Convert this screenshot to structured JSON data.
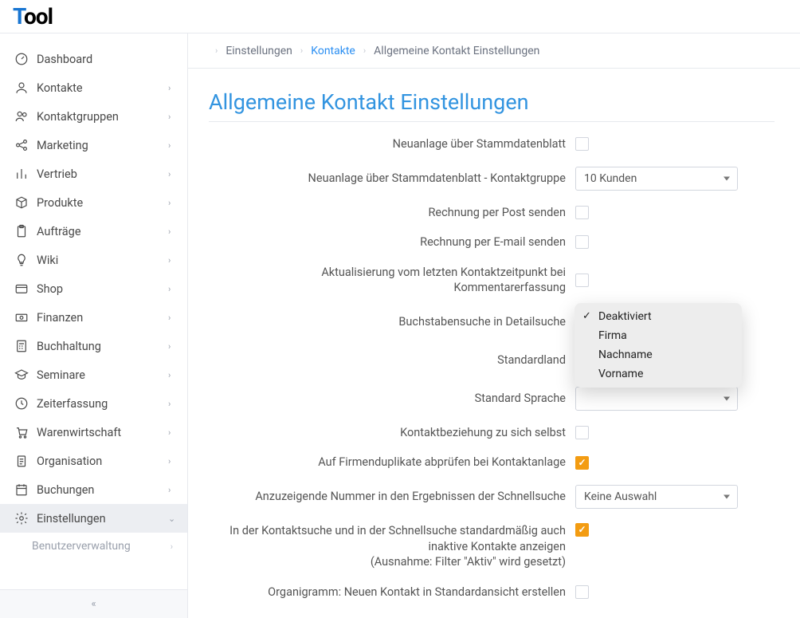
{
  "logo": {
    "t": "T",
    "rest": "ool"
  },
  "sidebar": {
    "items": [
      {
        "id": "dashboard",
        "label": "Dashboard",
        "icon": "gauge",
        "expandable": false
      },
      {
        "id": "kontakte",
        "label": "Kontakte",
        "icon": "user",
        "expandable": true
      },
      {
        "id": "kontaktgruppen",
        "label": "Kontaktgruppen",
        "icon": "users",
        "expandable": true
      },
      {
        "id": "marketing",
        "label": "Marketing",
        "icon": "share",
        "expandable": true
      },
      {
        "id": "vertrieb",
        "label": "Vertrieb",
        "icon": "bars",
        "expandable": true
      },
      {
        "id": "produkte",
        "label": "Produkte",
        "icon": "cube",
        "expandable": true
      },
      {
        "id": "auftraege",
        "label": "Aufträge",
        "icon": "clipboard",
        "expandable": true
      },
      {
        "id": "wiki",
        "label": "Wiki",
        "icon": "bulb",
        "expandable": true
      },
      {
        "id": "shop",
        "label": "Shop",
        "icon": "card",
        "expandable": true
      },
      {
        "id": "finanzen",
        "label": "Finanzen",
        "icon": "money",
        "expandable": true
      },
      {
        "id": "buchhaltung",
        "label": "Buchhaltung",
        "icon": "calc",
        "expandable": true
      },
      {
        "id": "seminare",
        "label": "Seminare",
        "icon": "gradcap",
        "expandable": true
      },
      {
        "id": "zeiterfassung",
        "label": "Zeiterfassung",
        "icon": "clock",
        "expandable": true
      },
      {
        "id": "warenwirtschaft",
        "label": "Warenwirtschaft",
        "icon": "cart",
        "expandable": true
      },
      {
        "id": "organisation",
        "label": "Organisation",
        "icon": "clipboard2",
        "expandable": true
      },
      {
        "id": "buchungen",
        "label": "Buchungen",
        "icon": "calendar",
        "expandable": true
      },
      {
        "id": "einstellungen",
        "label": "Einstellungen",
        "icon": "gear",
        "expandable": true,
        "active": true,
        "sub": [
          {
            "label": "Benutzerverwaltung",
            "expandable": true
          }
        ]
      }
    ]
  },
  "breadcrumb": {
    "items": [
      {
        "label": "Einstellungen",
        "type": "item"
      },
      {
        "label": "Kontakte",
        "type": "link"
      },
      {
        "label": "Allgemeine Kontakt Einstellungen",
        "type": "item"
      }
    ]
  },
  "page_title": "Allgemeine Kontakt Einstellungen",
  "form": {
    "rows": [
      {
        "label": "Neuanlage über Stammdatenblatt",
        "type": "checkbox",
        "checked": false
      },
      {
        "label": "Neuanlage über Stammdatenblatt - Kontaktgruppe",
        "type": "select",
        "value": "10 Kunden"
      },
      {
        "label": "Rechnung per Post senden",
        "type": "checkbox",
        "checked": false
      },
      {
        "label": "Rechnung per E-mail senden",
        "type": "checkbox",
        "checked": false
      },
      {
        "label": "Aktualisierung vom letzten Kontaktzeitpunkt bei Kommentarerfassung",
        "type": "checkbox",
        "checked": false
      },
      {
        "label": "Buchstabensuche in Detailsuche",
        "type": "select",
        "value": "",
        "accent": true,
        "has_dropdown": true
      },
      {
        "label": "Standardland",
        "type": "select",
        "value": ""
      },
      {
        "label": "Standard Sprache",
        "type": "select",
        "value": ""
      },
      {
        "label": "Kontaktbeziehung zu sich selbst",
        "type": "checkbox",
        "checked": false
      },
      {
        "label": "Auf Firmenduplikate abprüfen bei Kontaktanlage",
        "type": "checkbox",
        "checked": true
      },
      {
        "label": "Anzuzeigende Nummer in den Ergebnissen der Schnellsuche",
        "type": "select",
        "value": "Keine Auswahl"
      },
      {
        "label": "In der Kontaktsuche und in der Schnellsuche standardmäßig auch inaktive Kontakte anzeigen\n(Ausnahme: Filter \"Aktiv\" wird gesetzt)",
        "type": "checkbox",
        "checked": true,
        "multiline": true
      },
      {
        "label": "Organigramm: Neuen Kontakt in Standardansicht erstellen",
        "type": "checkbox",
        "checked": false
      }
    ]
  },
  "dropdown": {
    "options": [
      {
        "label": "Deaktiviert",
        "selected": true
      },
      {
        "label": "Firma",
        "selected": false
      },
      {
        "label": "Nachname",
        "selected": false
      },
      {
        "label": "Vorname",
        "selected": false
      }
    ]
  }
}
